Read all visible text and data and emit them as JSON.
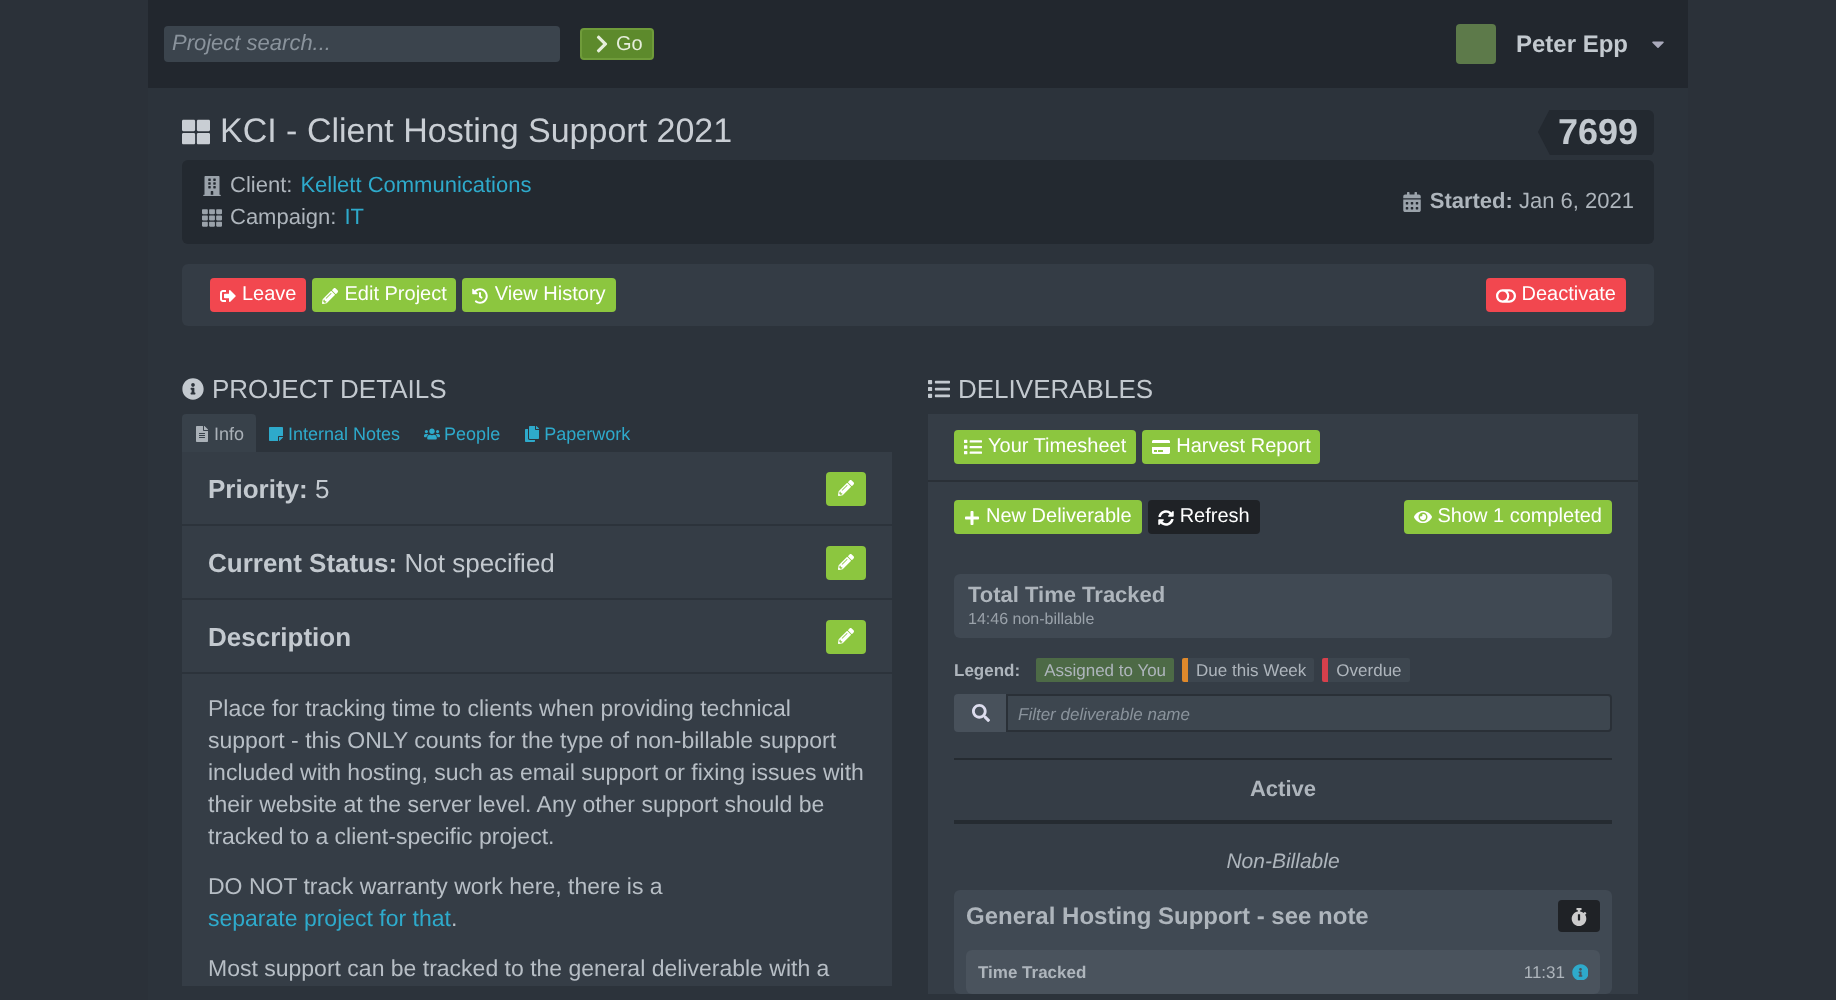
{
  "topbar": {
    "search_placeholder": "Project search...",
    "go_button": "Go",
    "user_name": "Peter Epp"
  },
  "project": {
    "title": "KCI - Client Hosting Support 2021",
    "number": "7699",
    "client_label": "Client:",
    "client": "Kellett Communications",
    "campaign_label": "Campaign:",
    "campaign": "IT",
    "started_label": "Started:",
    "started": "Jan 6, 2021"
  },
  "actions": [
    {
      "label": "Leave",
      "kind": "danger"
    },
    {
      "label": "Edit Project",
      "kind": "success"
    },
    {
      "label": "View History",
      "kind": "success"
    }
  ],
  "deactivate_button": "Deactivate",
  "details": {
    "heading": "PROJECT DETAILS",
    "tabs": [
      {
        "label": "Info",
        "selected": true
      },
      {
        "label": "Internal Notes",
        "selected": false
      },
      {
        "label": "People",
        "selected": false
      },
      {
        "label": "Paperwork",
        "selected": false
      }
    ],
    "fields": [
      {
        "label": "Priority:",
        "value": "5"
      },
      {
        "label": "Current Status:",
        "value": "Not specified"
      }
    ],
    "description_label": "Description",
    "paragraphs": [
      {
        "text": "Place for tracking time to clients when providing technical support - this ONLY counts for the type of non-billable support included with hosting, such as email support or fixing issues with their website at the server level. Any other support should be tracked to a client-specific project."
      },
      {
        "text": "DO NOT track warranty work here, there is a ",
        "link": "separate project for that",
        "after": "."
      },
      {
        "text": "Most support can be tracked to the general deliverable with a"
      }
    ]
  },
  "deliverables": {
    "heading": "DELIVERABLES",
    "toolbar": [
      "Your Timesheet",
      "Harvest Report"
    ],
    "new_button": "New Deliverable",
    "refresh_button": "Refresh",
    "show_completed": "Show 1 completed",
    "total": {
      "title": "Total Time Tracked",
      "subtitle": "14:46 non-billable"
    },
    "legend_label": "Legend:",
    "legend": [
      {
        "label": "Assigned to You",
        "kind": "fill",
        "color": "#4d6a46"
      },
      {
        "label": "Due this Week",
        "kind": "stripe",
        "color": "#e0892b"
      },
      {
        "label": "Overdue",
        "kind": "stripe",
        "color": "#d7404c"
      }
    ],
    "filter_placeholder": "Filter deliverable name",
    "section": "Active",
    "group": "Non-Billable",
    "card": {
      "title": "General Hosting Support - see note",
      "time_label": "Time Tracked",
      "time": "11:31"
    }
  }
}
